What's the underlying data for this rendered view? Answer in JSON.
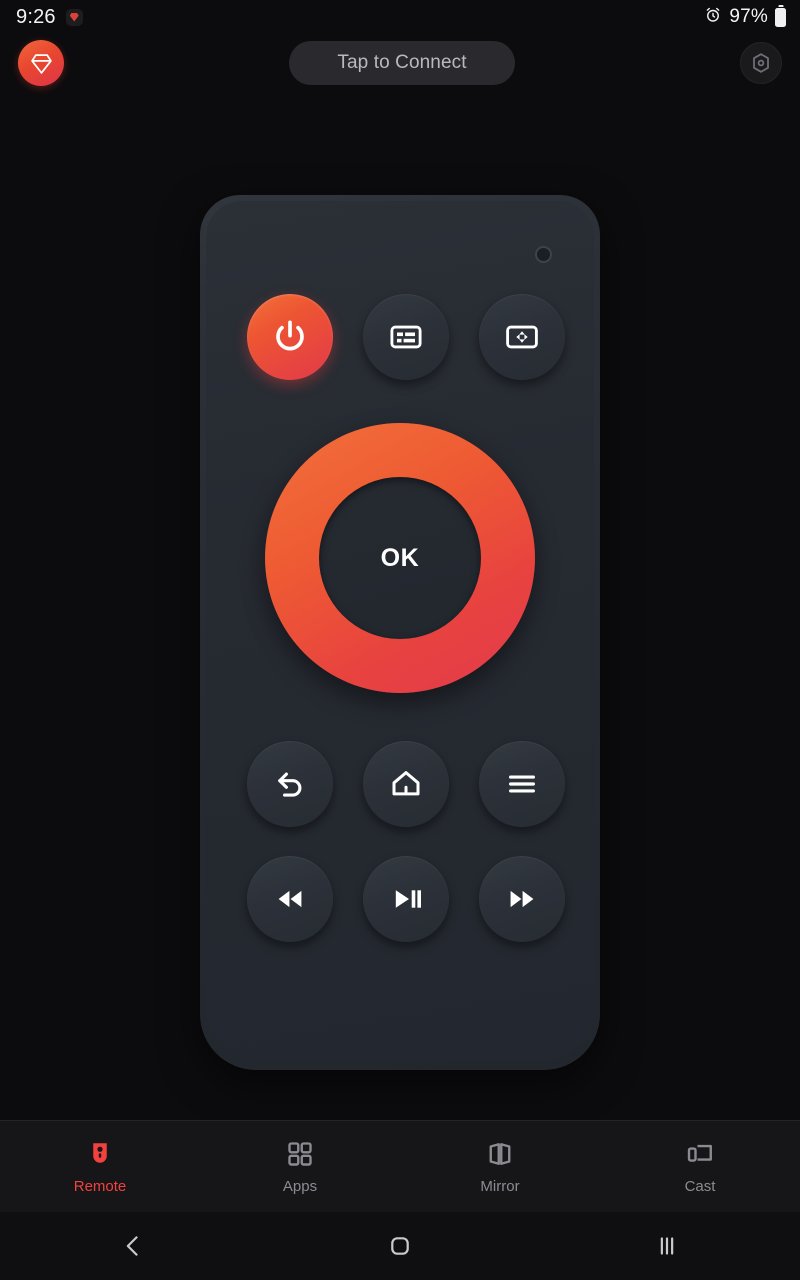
{
  "statusbar": {
    "time": "9:26",
    "notification_icon": "app-notification-icon",
    "alarm_icon": "alarm-clock-icon",
    "battery_percent": "97%",
    "battery_icon": "battery-full-icon"
  },
  "header": {
    "brand_icon": "diamond-gem-icon",
    "connect_label": "Tap to Connect",
    "settings_icon": "settings-gear-icon"
  },
  "remote": {
    "ir_led": "ir-led-indicator",
    "top_row": [
      {
        "name": "power-button",
        "icon": "power-icon",
        "accent": "#ed5532"
      },
      {
        "name": "keyboard-button",
        "icon": "keyboard-icon"
      },
      {
        "name": "touchpad-button",
        "icon": "dpad-screen-icon"
      }
    ],
    "dpad": {
      "ok_label": "OK",
      "ring_color_start": "#f2703b",
      "ring_color_end": "#e23a4e"
    },
    "nav_row": [
      {
        "name": "back-button",
        "icon": "back-arrow-icon"
      },
      {
        "name": "home-button",
        "icon": "home-icon"
      },
      {
        "name": "menu-button",
        "icon": "menu-hamburger-icon"
      }
    ],
    "media_row": [
      {
        "name": "rewind-button",
        "icon": "rewind-icon"
      },
      {
        "name": "play-pause-button",
        "icon": "play-pause-icon"
      },
      {
        "name": "forward-button",
        "icon": "fast-forward-icon"
      }
    ]
  },
  "tabbar": {
    "active_color": "#f2413f",
    "inactive_color": "#8b8b92",
    "items": [
      {
        "label": "Remote",
        "icon": "remote-icon",
        "active": true
      },
      {
        "label": "Apps",
        "icon": "apps-grid-icon",
        "active": false
      },
      {
        "label": "Mirror",
        "icon": "screen-mirror-icon",
        "active": false
      },
      {
        "label": "Cast",
        "icon": "cast-screen-icon",
        "active": false
      }
    ]
  },
  "navbar": {
    "back": "nav-back-icon",
    "home": "nav-home-icon",
    "recents": "nav-recents-icon"
  }
}
